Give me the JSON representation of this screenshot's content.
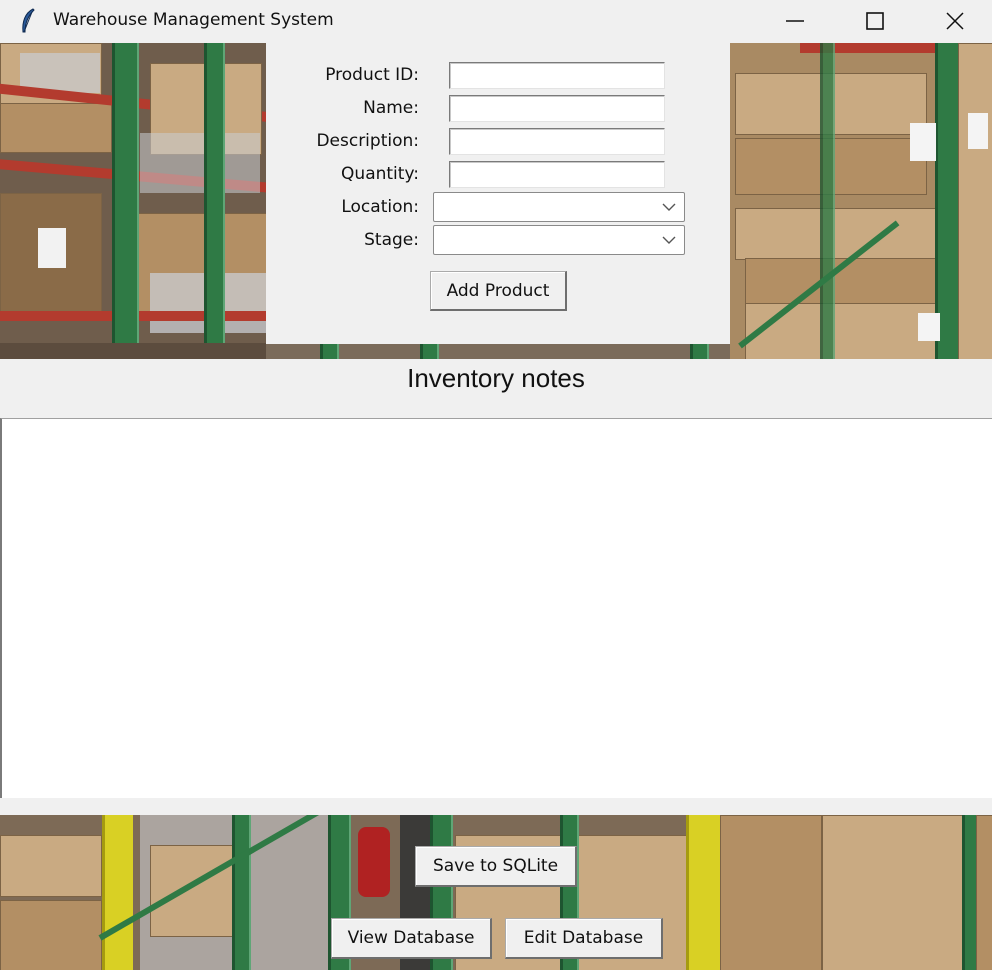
{
  "window": {
    "title": "Warehouse Management System",
    "icons": {
      "app": "feather-icon",
      "minimize": "minimize-icon",
      "maximize": "maximize-icon",
      "close": "close-icon"
    }
  },
  "form": {
    "product_id_label": "Product ID:",
    "product_id_value": "",
    "name_label": "Name:",
    "name_value": "",
    "description_label": "Description:",
    "description_value": "",
    "quantity_label": "Quantity:",
    "quantity_value": "",
    "location_label": "Location:",
    "location_value": "",
    "stage_label": "Stage:",
    "stage_value": "",
    "add_button": "Add Product"
  },
  "notes": {
    "title": "Inventory notes",
    "value": ""
  },
  "actions": {
    "save": "Save to SQLite",
    "view": "View Database",
    "edit": "Edit Database"
  },
  "background": {
    "image": "warehouse-shelves-photo"
  }
}
